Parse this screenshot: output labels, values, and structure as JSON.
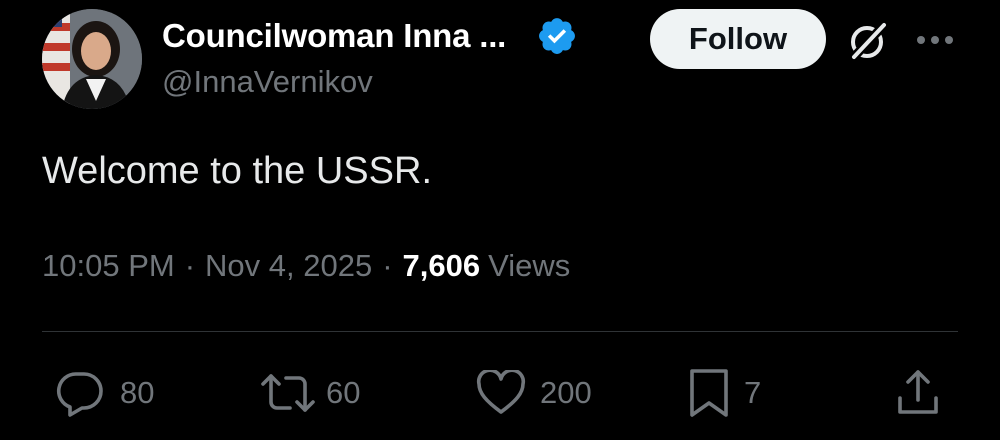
{
  "author": {
    "display_name": "Councilwoman Inna ...",
    "handle": "@InnaVernikov",
    "verified": true
  },
  "header": {
    "follow_label": "Follow",
    "icons": [
      "verified-badge-icon",
      "grok-icon",
      "more-icon"
    ]
  },
  "tweet": {
    "text": "Welcome to the USSR.",
    "time": "10:05 PM",
    "separator": "·",
    "date": "Nov 4, 2025",
    "views_count": "7,606",
    "views_label": "Views"
  },
  "actions": {
    "replies": "80",
    "reposts": "60",
    "likes": "200",
    "bookmarks": "7"
  },
  "colors": {
    "background": "#000000",
    "primary_text": "#e7e9ea",
    "secondary_text": "#71767b",
    "verified_blue": "#1d9bf0",
    "follow_bg": "#eff3f4",
    "divider": "#2f3336"
  }
}
